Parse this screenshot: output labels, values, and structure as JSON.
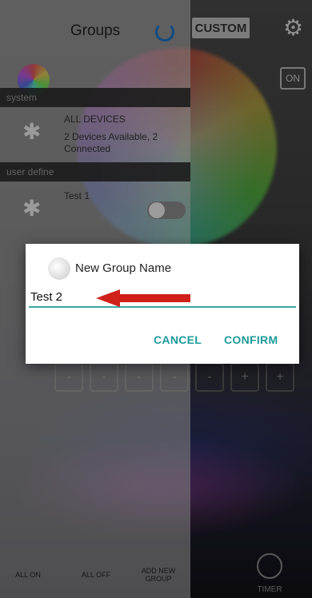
{
  "background": {
    "custom_label": "CUSTOM",
    "on_label": "ON",
    "slot_marks": [
      "-",
      "-",
      "-",
      "-",
      "-",
      "+",
      "+"
    ],
    "timer_label": "TIMER",
    "icons": {
      "gear": "gear-icon",
      "timer": "clock-icon"
    }
  },
  "panel": {
    "title": "Groups",
    "refresh_icon": "refresh-icon",
    "section_system": "system",
    "section_user": "user define",
    "all_devices": {
      "title": "ALL DEVICES",
      "subtitle": "2 Devices Available, 2 Connected"
    },
    "test1": {
      "title": "Test 1",
      "toggle_on": false
    },
    "footer": {
      "all_on": "ALL ON",
      "all_off": "ALL OFF",
      "add_group": "ADD NEW GROUP"
    }
  },
  "dialog": {
    "title": "New Group Name",
    "input_value": "Test 2",
    "cancel": "CANCEL",
    "confirm": "CONFIRM",
    "accent_color": "#1f9b9b",
    "arrow_color": "#d0201a"
  }
}
